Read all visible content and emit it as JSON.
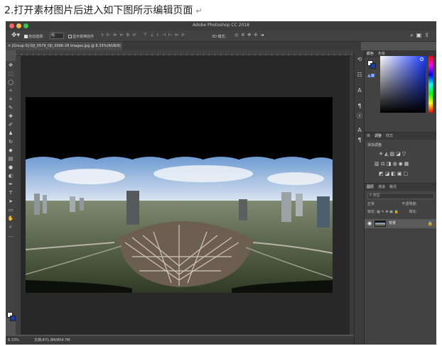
{
  "doc_heading": "2.打开素材图片后进入如下图所示编辑页面",
  "doc_heading_mark": "↵",
  "window": {
    "title": "Adobe Photoshop CC 2018"
  },
  "options_bar": {
    "move_icon": "move-tool-icon",
    "auto_select_label": "自动选择:",
    "auto_select_value": "组",
    "show_transform_label": "显示变换控件",
    "mode_3d_label": "3D 模式:",
    "right_icons": "search-icon, workspace-icon, share-icon"
  },
  "document_tab": {
    "label": "[Group 0]-DJI_0579_OJI_0006-28 images.jpg @ 8.33%(RGB/8)"
  },
  "toolbar": {
    "tools": [
      "move-tool",
      "marquee-tool",
      "lasso-tool",
      "magic-wand-tool",
      "crop-tool",
      "eyedropper-tool",
      "healing-brush-tool",
      "brush-tool",
      "clone-stamp-tool",
      "history-brush-tool",
      "eraser-tool",
      "gradient-tool",
      "blur-tool",
      "dodge-tool",
      "pen-tool",
      "type-tool",
      "path-selection-tool",
      "rectangle-tool",
      "hand-tool",
      "zoom-tool",
      "edit-toolbar",
      "swap-colors"
    ]
  },
  "status_bar": {
    "zoom": "8.33%",
    "doc_info": "文档:871.8M/854.7M"
  },
  "panels": {
    "color": {
      "tabs": [
        "颜色",
        "色板"
      ],
      "foreground": "#ffffff",
      "background": "#1b3ea6"
    },
    "adjustments": {
      "tabs": [
        "库",
        "调整",
        "样式"
      ],
      "add_label": "添加调整"
    },
    "layers": {
      "tabs": [
        "图层",
        "通道",
        "路径"
      ],
      "search_placeholder": "P 类型",
      "mode": "正常",
      "opacity_label": "不透明度:",
      "lock_label": "锁定:",
      "fill_label": "填充:",
      "layer_name": "背景"
    }
  },
  "colors": {
    "app_bg": "#535353",
    "panel_bg": "#424242",
    "canvas_bg": "#282828",
    "accent_blue": "#1b3ea6"
  }
}
